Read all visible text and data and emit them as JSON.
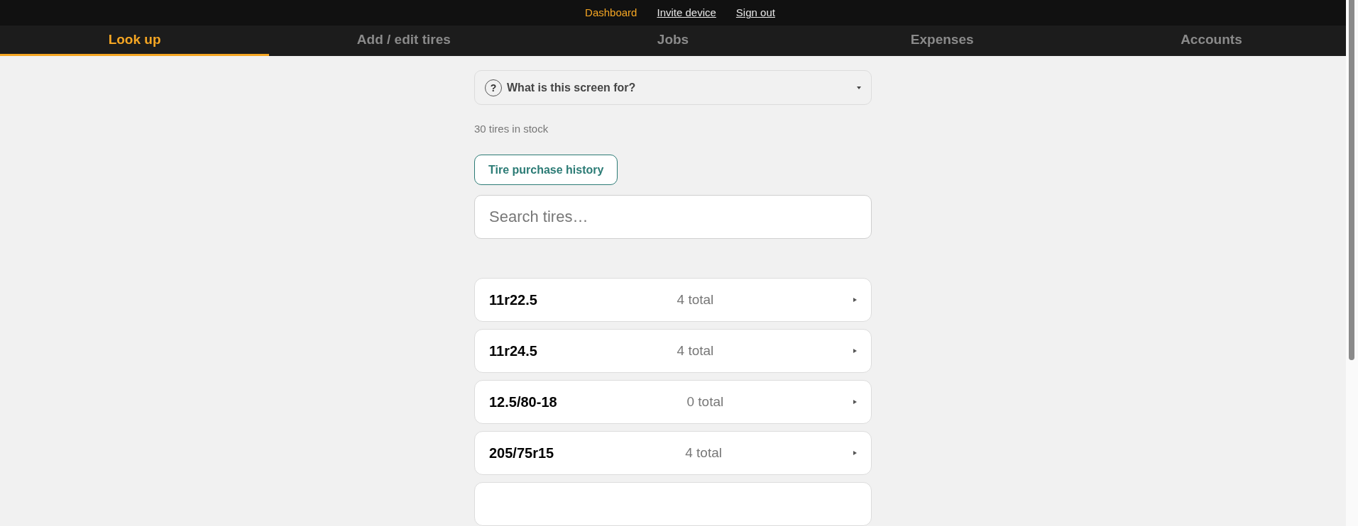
{
  "top_links": [
    {
      "label": "Dashboard",
      "selected": true
    },
    {
      "label": "Invite device",
      "selected": false
    },
    {
      "label": "Sign out",
      "selected": false
    }
  ],
  "tabs": [
    {
      "label": "Look up",
      "selected": true
    },
    {
      "label": "Add / edit tires",
      "selected": false
    },
    {
      "label": "Jobs",
      "selected": false
    },
    {
      "label": "Expenses",
      "selected": false
    },
    {
      "label": "Accounts",
      "selected": false
    }
  ],
  "help": {
    "icon": "?",
    "title": "What is this screen for?",
    "expanded": false
  },
  "stock_count": "30 tires in stock",
  "history_button": "Tire purchase history",
  "search": {
    "placeholder": "Search tires…"
  },
  "tire_sizes": [
    {
      "size": "11r22.5",
      "total": "4 total"
    },
    {
      "size": "11r24.5",
      "total": "4 total"
    },
    {
      "size": "12.5/80-18",
      "total": "0 total"
    },
    {
      "size": "205/75r15",
      "total": "4 total"
    }
  ]
}
